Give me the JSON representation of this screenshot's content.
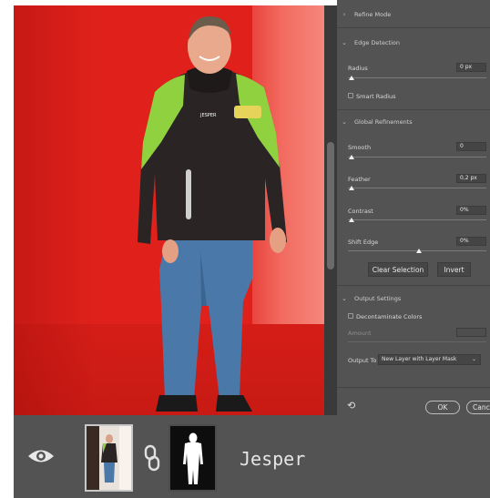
{
  "panel": {
    "refine_mode": {
      "label": "Refine Mode"
    },
    "edge_detection": {
      "label": "Edge Detection",
      "radius_label": "Radius",
      "radius_value": "0 px",
      "smart_radius_label": "Smart Radius"
    },
    "global_refinements": {
      "label": "Global Refinements",
      "smooth_label": "Smooth",
      "smooth_value": "0",
      "feather_label": "Feather",
      "feather_value": "0,2 px",
      "contrast_label": "Contrast",
      "contrast_value": "0%",
      "shift_edge_label": "Shift Edge",
      "shift_edge_value": "0%"
    },
    "buttons": {
      "clear_selection": "Clear Selection",
      "invert": "Invert",
      "ok": "OK",
      "cancel": "Canc"
    },
    "output_settings": {
      "label": "Output Settings",
      "decontaminate_label": "Decontaminate Colors",
      "amount_label": "Amount",
      "output_to_label": "Output To",
      "output_to_value": "New Layer with Layer Mask"
    },
    "icons": {
      "collapsed_chevron": "›",
      "expanded_chevron": "⌄",
      "select_arrow": "⌄",
      "reset": "⟲"
    }
  },
  "canvas": {
    "jacket_text_left": "JESPER"
  },
  "layer": {
    "name": "Jesper"
  },
  "colors": {
    "overlay_red": "#e0211b",
    "panel_bg": "#535353",
    "jacket_green": "#8fd13f",
    "jacket_black": "#2a2424",
    "jeans_blue": "#4a78a8"
  }
}
